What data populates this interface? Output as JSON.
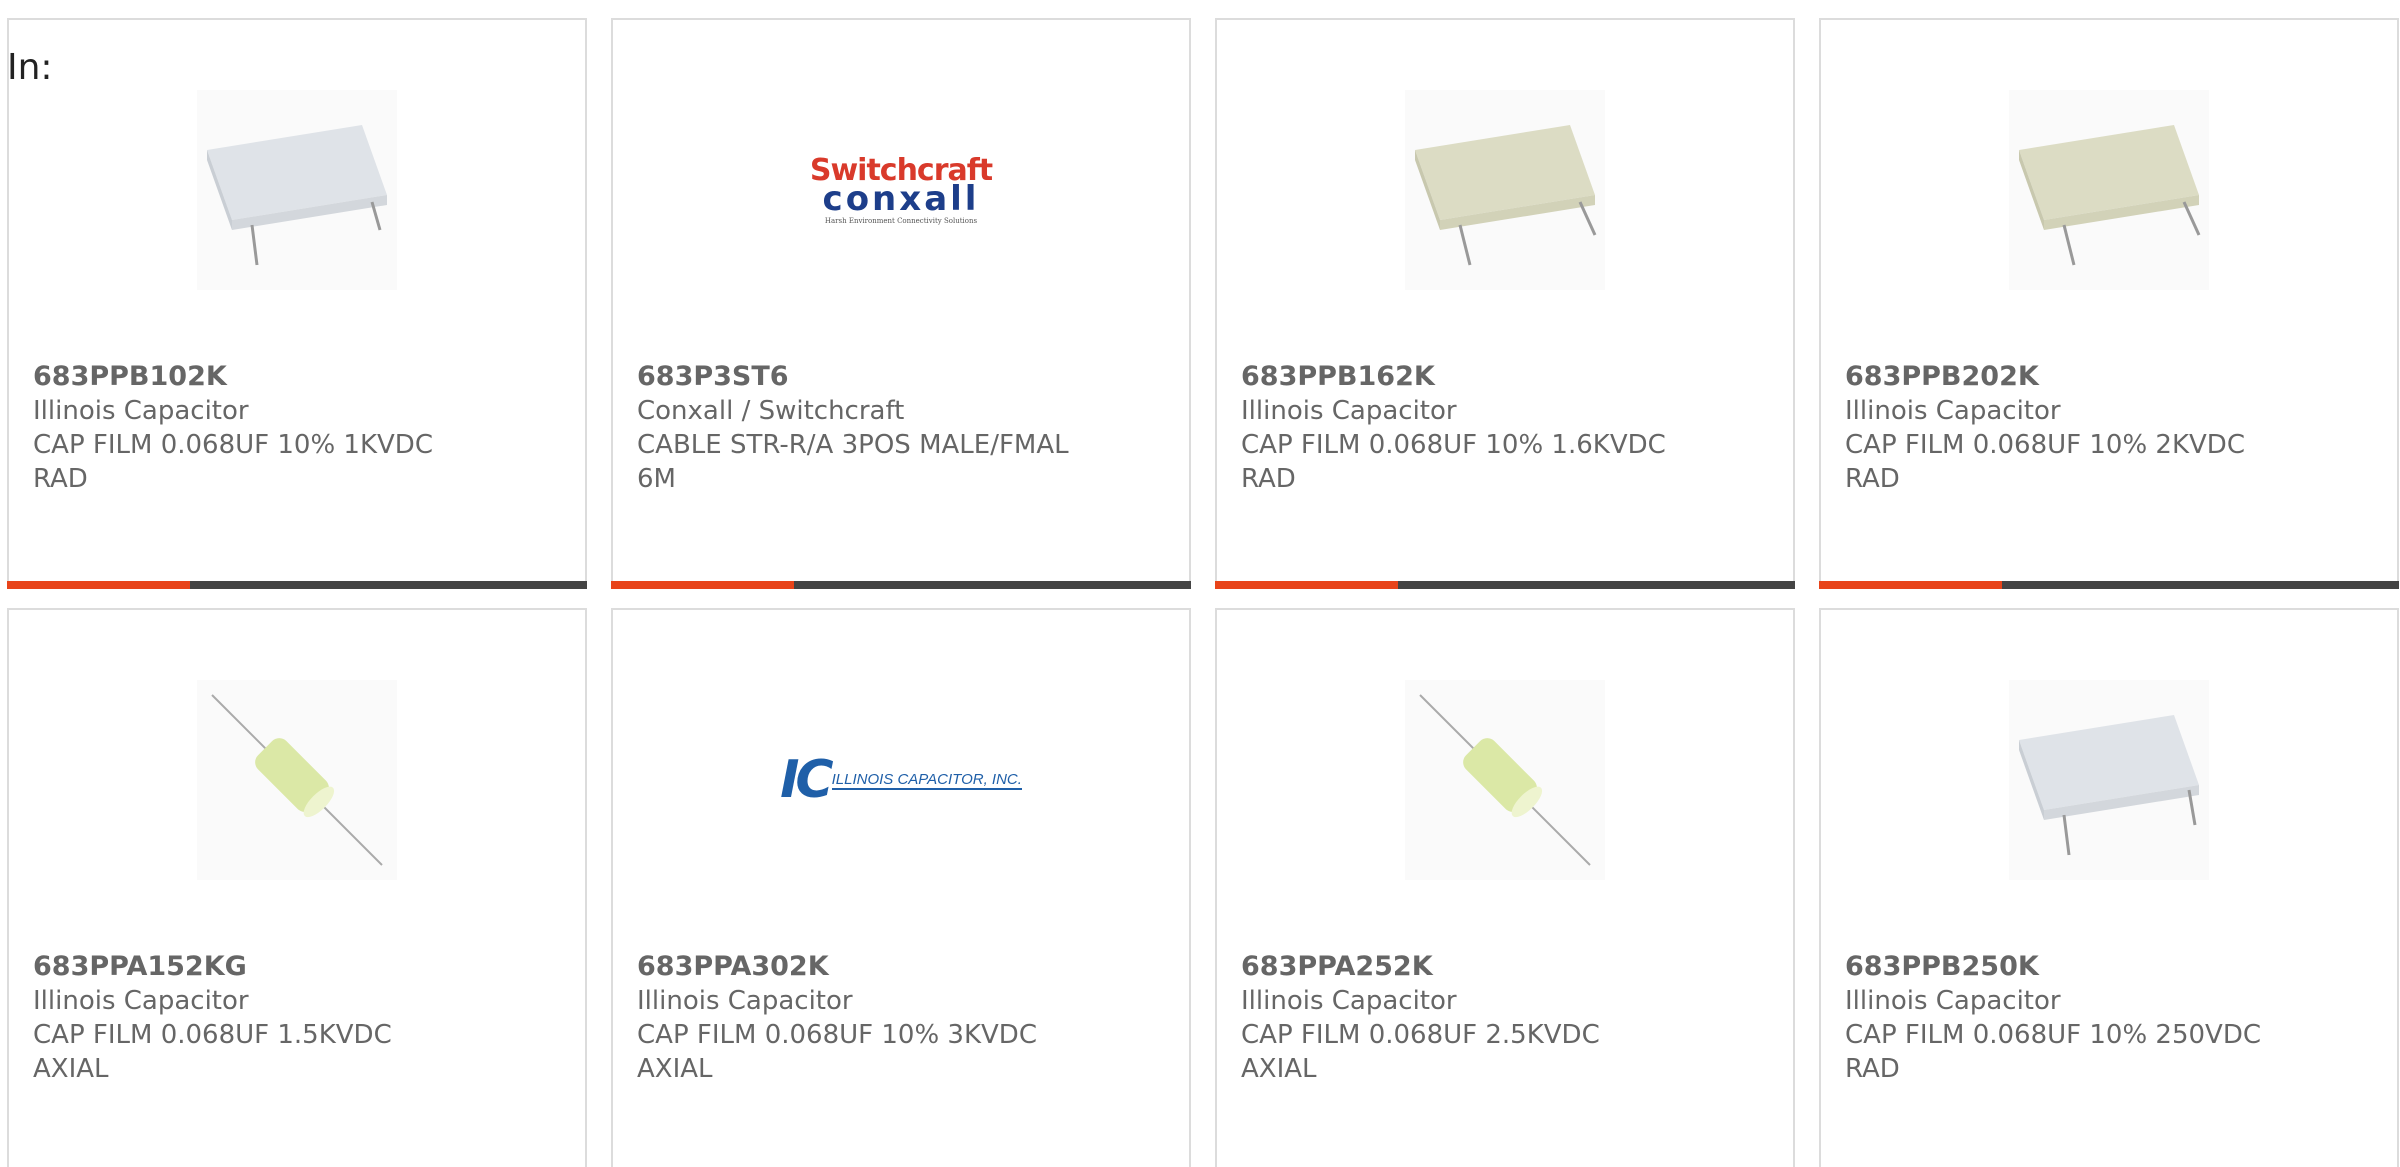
{
  "header": {
    "in_label": "In:"
  },
  "products": [
    {
      "part_number": "683PPB102K",
      "manufacturer": "Illinois Capacitor",
      "description_line1": "CAP FILM 0.068UF 10% 1KVDC",
      "description_line2": "RAD",
      "image": "box-capacitor-white"
    },
    {
      "part_number": "683P3ST6",
      "manufacturer": "Conxall / Switchcraft",
      "description_line1": "CABLE STR-R/A 3POS MALE/FMAL",
      "description_line2": "6M",
      "image": "switchcraft-logo"
    },
    {
      "part_number": "683PPB162K",
      "manufacturer": "Illinois Capacitor",
      "description_line1": "CAP FILM 0.068UF 10% 1.6KVDC",
      "description_line2": "RAD",
      "image": "box-capacitor-beige"
    },
    {
      "part_number": "683PPB202K",
      "manufacturer": "Illinois Capacitor",
      "description_line1": "CAP FILM 0.068UF 10% 2KVDC",
      "description_line2": "RAD",
      "image": "box-capacitor-beige"
    },
    {
      "part_number": "683PPA152KG",
      "manufacturer": "Illinois Capacitor",
      "description_line1": "CAP FILM 0.068UF 1.5KVDC",
      "description_line2": "AXIAL",
      "image": "axial-capacitor-green"
    },
    {
      "part_number": "683PPA302K",
      "manufacturer": "Illinois Capacitor",
      "description_line1": "CAP FILM 0.068UF 10% 3KVDC",
      "description_line2": "AXIAL",
      "image": "illinois-capacitor-logo"
    },
    {
      "part_number": "683PPA252K",
      "manufacturer": "Illinois Capacitor",
      "description_line1": "CAP FILM 0.068UF 2.5KVDC",
      "description_line2": "AXIAL",
      "image": "axial-capacitor-green"
    },
    {
      "part_number": "683PPB250K",
      "manufacturer": "Illinois Capacitor",
      "description_line1": "CAP FILM 0.068UF 10% 250VDC",
      "description_line2": "RAD",
      "image": "box-capacitor-white"
    }
  ],
  "logos": {
    "switchcraft_top": "Switchcraft",
    "switchcraft_bottom": "conxall",
    "switchcraft_tagline": "Harsh Environment Connectivity Solutions",
    "illinois_mark": "IC",
    "illinois_name": "ILLINOIS CAPACITOR, INC."
  },
  "colors": {
    "accent": "#e8441a",
    "bar": "#444444",
    "text": "#666666",
    "switchcraft_red": "#d93a2b",
    "conxall_blue": "#1d3e8a",
    "illinois_blue": "#1f5fa8"
  }
}
